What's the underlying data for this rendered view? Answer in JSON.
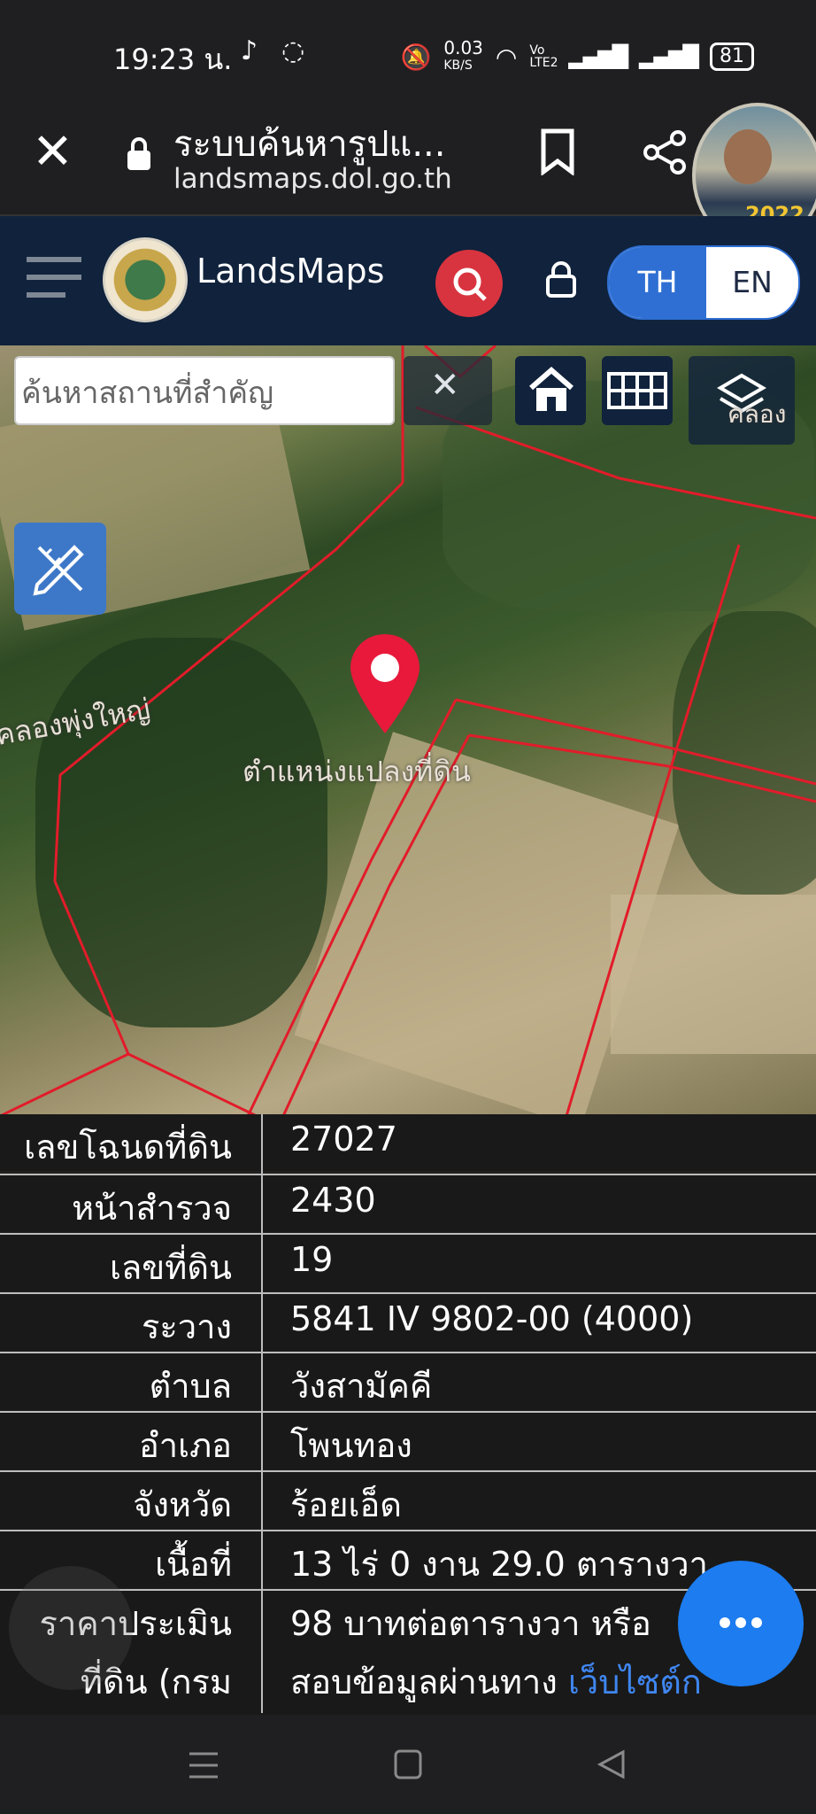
{
  "status_bar": {
    "time": "19:23 น.",
    "net_speed": "0.03",
    "net_unit": "KB/S",
    "volte": "Vo LTE2",
    "battery": "81"
  },
  "browser": {
    "title": "ระบบค้นหารูปแ...",
    "url": "landsmaps.dol.go.th",
    "avatar_badge": "2022"
  },
  "app_header": {
    "brand": "LandsMaps",
    "lang_th": "TH",
    "lang_en": "EN"
  },
  "map": {
    "search_placeholder": "ค้นหาสถานที่สำคัญ",
    "marker_label": "ตำแหน่งแปลงที่ดิน",
    "canal_label": "คลองพุ่งใหญ่",
    "corner_label": "คลอง"
  },
  "info_table": {
    "rows": [
      {
        "label": "เลขโฉนดที่ดิน",
        "value": "27027"
      },
      {
        "label": "หน้าสำรวจ",
        "value": "2430"
      },
      {
        "label": "เลขที่ดิน",
        "value": "19"
      },
      {
        "label": "ระวาง",
        "value": "5841 IV 9802-00 (4000)"
      },
      {
        "label": "ตำบล",
        "value": "วังสามัคคี"
      },
      {
        "label": "อำเภอ",
        "value": "โพนทอง"
      },
      {
        "label": "จังหวัด",
        "value": "ร้อยเอ็ด"
      },
      {
        "label": "เนื้อที่",
        "value": "13 ไร่ 0 งาน 29.0 ตารางวา"
      }
    ],
    "price_label_1": "ราคาประเมิน",
    "price_label_2": "ที่ดิน (กรม",
    "price_value_1": "98 บาทต่อตารางวา หรือ",
    "price_value_2": "สอบข้อมูลผ่านทาง",
    "price_link": "เว็บไซต์ก"
  },
  "colors": {
    "header": "#10223c",
    "accent": "#2f6fd3",
    "search_red": "#d8343f",
    "parcel_line": "#e21c2a",
    "fab": "#1c7cf0"
  }
}
